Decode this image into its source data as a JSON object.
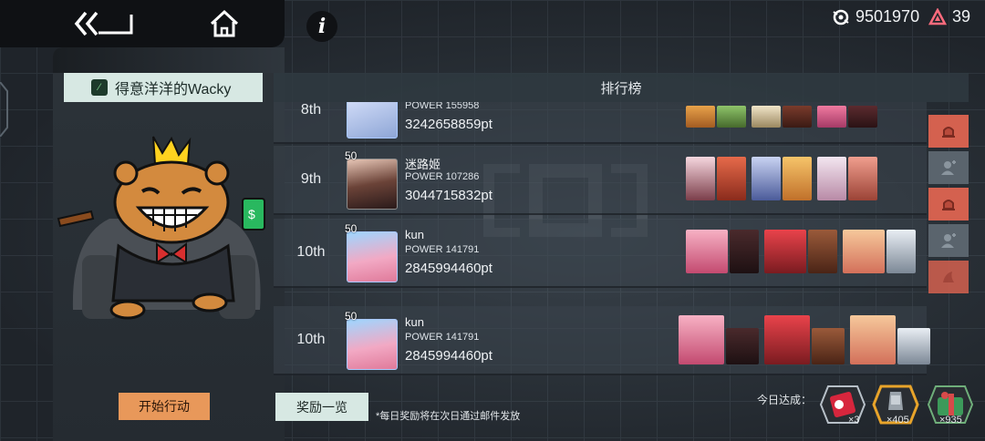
{
  "currencies": {
    "gene_amount": "9501970",
    "gem_amount": "39"
  },
  "player_title": "得意洋洋的Wacky",
  "ranking_header": "排行榜",
  "rows": [
    {
      "rank": "8th",
      "name": "",
      "power": "POWER 155958",
      "points": "3242658859pt",
      "level": ""
    },
    {
      "rank": "9th",
      "name": "迷路姬",
      "power": "POWER 107286",
      "points": "3044715832pt",
      "level": "50"
    },
    {
      "rank": "10th",
      "name": "kun",
      "power": "POWER 141791",
      "points": "2845994460pt",
      "level": "50"
    },
    {
      "rank": "10th",
      "name": "kun",
      "power": "POWER 141791",
      "points": "2845994460pt",
      "level": "50"
    }
  ],
  "buttons": {
    "start_action": "开始行动",
    "reward_list": "奖励一览"
  },
  "note": "*每日奖励将在次日通过邮件发放",
  "today_label": "今日达成：",
  "achievements": [
    {
      "count": "×3",
      "icon": "red-ticket-icon"
    },
    {
      "count": "×405",
      "icon": "gold-ingot-icon"
    },
    {
      "count": "×935",
      "icon": "green-gift-icon"
    }
  ],
  "colors": {
    "accent_orange": "#e8985a",
    "accent_mint": "#d7e8e3",
    "side_red": "#d4614f"
  }
}
